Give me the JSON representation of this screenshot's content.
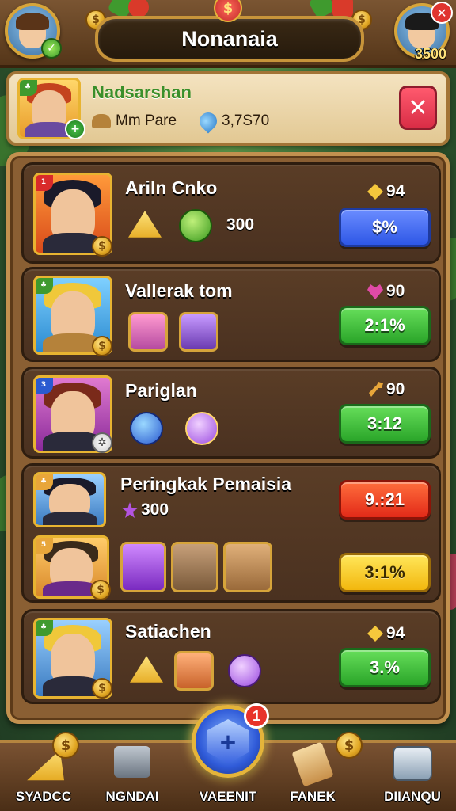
{
  "header": {
    "title": "Nonanaia",
    "currency_amount": "3500"
  },
  "player": {
    "name": "Nadsarshan",
    "stat_label": "Mm Pare",
    "stat_value": "3,7S70"
  },
  "rows": [
    {
      "name": "Ariln Cnko",
      "score": "94",
      "score_icon": "gold-gem",
      "button": "$%",
      "button_color": "blue",
      "item_amount": "300"
    },
    {
      "name": "Vallerak tom",
      "score": "90",
      "score_icon": "pink-heart",
      "button": "2:1%",
      "button_color": "green"
    },
    {
      "name": "Pariglan",
      "score": "90",
      "score_icon": "wrench",
      "button": "3:12",
      "button_color": "green"
    },
    {
      "name": "Peringkak Pemaisia",
      "item_amount": "300",
      "item_icon": "star-gem",
      "button": "9.:21",
      "button_color": "red",
      "button2": "3:1%",
      "button2_color": "yellow"
    },
    {
      "name": "Satiachen",
      "score": "94",
      "score_icon": "gold-gem",
      "button": "3.%",
      "button_color": "green"
    }
  ],
  "nav": {
    "items": [
      {
        "label": "SYADCC",
        "icon": "cheese-wedge-icon"
      },
      {
        "label": "NGNDAI",
        "icon": "hammer-icon"
      },
      {
        "label": "VAEENIT",
        "icon": "blue-gem-icon"
      },
      {
        "label": "FANEK",
        "icon": "book-icon"
      },
      {
        "label": "DIIANQU",
        "icon": "chest-icon"
      }
    ],
    "center_badge": "1"
  },
  "colors": {
    "wood": "#7a5532",
    "panel_cream": "#f4e3c0",
    "name_green": "#3a8f2a",
    "btn_blue": "#2e57e6",
    "btn_green": "#2aa529",
    "btn_red": "#e22a18",
    "btn_yellow": "#f2b70e"
  }
}
